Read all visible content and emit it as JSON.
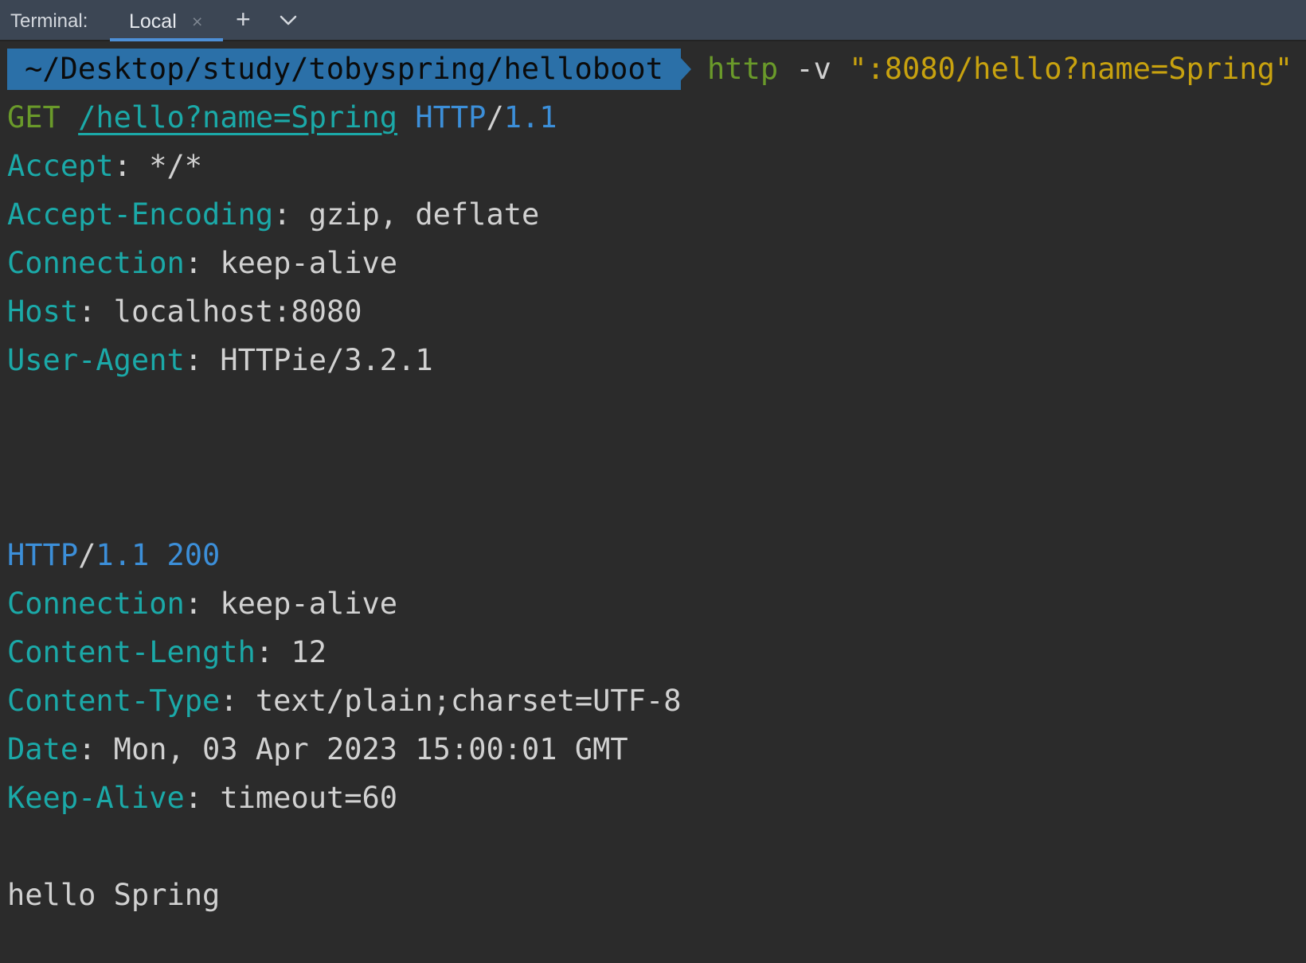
{
  "toolbar": {
    "title": "Terminal:",
    "tab_label": "Local",
    "close_glyph": "×",
    "add_glyph": "+"
  },
  "prompt": {
    "path": "~/Desktop/study/tobyspring/helloboot",
    "command": "http",
    "flag": "-v",
    "argument": "\":8080/hello?name=Spring\""
  },
  "request": {
    "method": "GET",
    "path": "/hello?name=Spring",
    "protocol": "HTTP",
    "version": "1.1",
    "headers": [
      {
        "name": "Accept",
        "value": "*/*"
      },
      {
        "name": "Accept-Encoding",
        "value": "gzip, deflate"
      },
      {
        "name": "Connection",
        "value": "keep-alive"
      },
      {
        "name": "Host",
        "value": "localhost:8080"
      },
      {
        "name": "User-Agent",
        "value": "HTTPie/3.2.1"
      }
    ]
  },
  "response": {
    "protocol": "HTTP",
    "version": "1.1",
    "status": "200",
    "headers": [
      {
        "name": "Connection",
        "value": "keep-alive"
      },
      {
        "name": "Content-Length",
        "value": "12"
      },
      {
        "name": "Content-Type",
        "value": "text/plain;charset=UTF-8"
      },
      {
        "name": "Date",
        "value": "Mon, 03 Apr 2023 15:00:01 GMT"
      },
      {
        "name": "Keep-Alive",
        "value": "timeout=60"
      }
    ],
    "body": "hello Spring"
  },
  "colors": {
    "background": "#2b2b2b",
    "toolbar": "#3c4654",
    "tab_underline": "#4d8fd6",
    "prompt_bg": "#2b70a8",
    "green": "#6a9a2a",
    "teal": "#1ba9a8",
    "blue": "#3c8fd9",
    "yellow": "#c8a20f"
  }
}
